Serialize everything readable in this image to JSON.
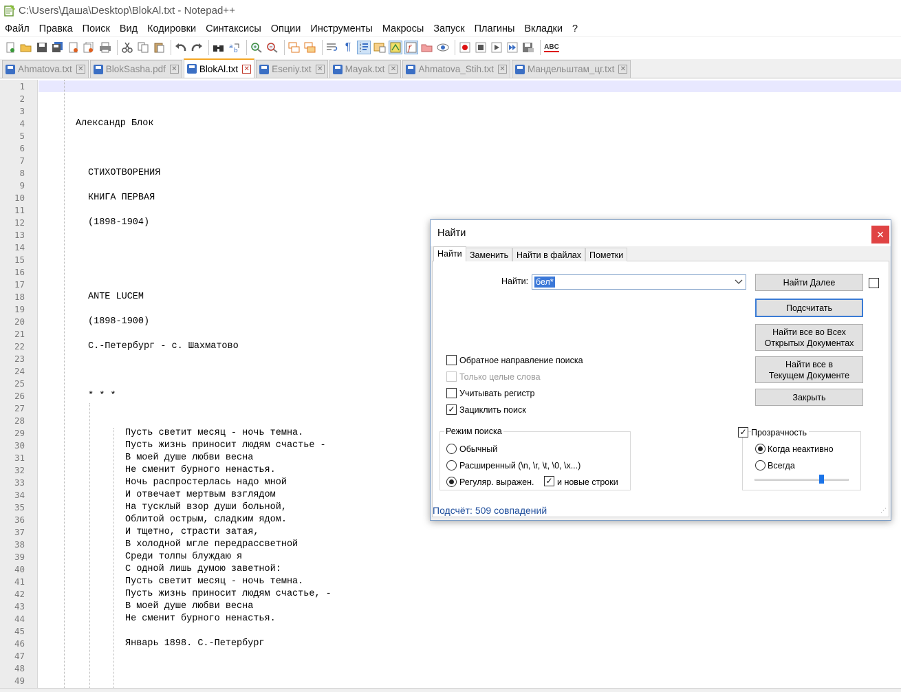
{
  "window": {
    "title": "C:\\Users\\Даша\\Desktop\\BlokAl.txt - Notepad++"
  },
  "menu": [
    "Файл",
    "Правка",
    "Поиск",
    "Вид",
    "Кодировки",
    "Синтаксисы",
    "Опции",
    "Инструменты",
    "Макросы",
    "Запуск",
    "Плагины",
    "Вкладки",
    "?"
  ],
  "toolbar": {
    "spell_label": "ABC"
  },
  "tabs": [
    {
      "label": "Ahmatova.txt",
      "active": false
    },
    {
      "label": "BlokSasha.pdf",
      "active": false
    },
    {
      "label": "BlokAl.txt",
      "active": true
    },
    {
      "label": "Eseniy.txt",
      "active": false
    },
    {
      "label": "Mayak.txt",
      "active": false
    },
    {
      "label": "Ahmatova_Stih.txt",
      "active": false
    },
    {
      "label": "Мандельштам_цг.txt",
      "active": false
    }
  ],
  "editor": {
    "line_numbers": [
      "1",
      "2",
      "3",
      "4",
      "5",
      "6",
      "7",
      "8",
      "9",
      "10",
      "11",
      "12",
      "13",
      "14",
      "15",
      "16",
      "17",
      "18",
      "19",
      "20",
      "21",
      "22",
      "23",
      "24",
      "25",
      "26",
      "27",
      "28",
      "29",
      "30",
      "31",
      "32",
      "33",
      "34",
      "35",
      "36",
      "37",
      "38",
      "39",
      "40",
      "41",
      "42",
      "43",
      "44",
      "45",
      "46",
      "47",
      "48",
      "49"
    ],
    "lines": [
      {
        "n": 4,
        "text": "Александр Блок"
      },
      {
        "n": 8,
        "text": "СТИХОТВОРЕНИЯ"
      },
      {
        "n": 10,
        "text": "КНИГА ПЕРВАЯ"
      },
      {
        "n": 12,
        "text": "(1898-1904)"
      },
      {
        "n": 18,
        "text": "ANTE LUCEM"
      },
      {
        "n": 20,
        "text": "(1898-1900)"
      },
      {
        "n": 22,
        "text": "С.-Петербург - с. Шахматово"
      },
      {
        "n": 26,
        "text": "* * *"
      },
      {
        "n": 29,
        "text": "Пусть светит месяц - ночь темна."
      },
      {
        "n": 30,
        "text": "Пусть жизнь приносит людям счастье -"
      },
      {
        "n": 31,
        "text": "В моей душе любви весна"
      },
      {
        "n": 32,
        "text": "Не сменит бурного ненастья."
      },
      {
        "n": 33,
        "text": "Ночь распростерлась надо мной"
      },
      {
        "n": 34,
        "text": "И отвечает мертвым взглядом"
      },
      {
        "n": 35,
        "text": "На тусклый взор души больной,"
      },
      {
        "n": 36,
        "text": "Облитой острым, сладким ядом."
      },
      {
        "n": 37,
        "text": "И тщетно, страсти затая,"
      },
      {
        "n": 38,
        "text": "В холодной мгле передрассветной"
      },
      {
        "n": 39,
        "text": "Среди толпы блуждаю я"
      },
      {
        "n": 40,
        "text": "С одной лишь думою заветной:"
      },
      {
        "n": 41,
        "text": "Пусть светит месяц - ночь темна."
      },
      {
        "n": 42,
        "text": "Пусть жизнь приносит людям счастье, -"
      },
      {
        "n": 43,
        "text": "В моей душе любви весна"
      },
      {
        "n": 44,
        "text": "Не сменит бурного ненастья."
      },
      {
        "n": 46,
        "text": "Январь 1898. С.-Петербург"
      }
    ]
  },
  "find_dialog": {
    "title": "Найти",
    "close": "✕",
    "tabs": [
      "Найти",
      "Заменить",
      "Найти в файлах",
      "Пометки"
    ],
    "find_label": "Найти:",
    "find_value": "бел*",
    "buttons": {
      "find_next": "Найти Далее",
      "count": "Подсчитать",
      "find_all_open_1": "Найти все во Всех",
      "find_all_open_2": "Открытых Документах",
      "find_all_current_1": "Найти все в",
      "find_all_current_2": "Текущем Документе",
      "close": "Закрыть"
    },
    "options": {
      "backward": {
        "label": "Обратное направление поиска",
        "checked": false
      },
      "whole_word": {
        "label": "Только целые слова",
        "checked": false,
        "disabled": true
      },
      "match_case": {
        "label": "Учитывать регистр",
        "checked": false
      },
      "wrap": {
        "label": "Зациклить поиск",
        "checked": true
      }
    },
    "search_mode": {
      "title": "Режим поиска",
      "normal": "Обычный",
      "extended": "Расширенный (\\n, \\r, \\t, \\0, \\x...)",
      "regex": "Регуляр. выражен.",
      "newline": "и новые строки",
      "selected": "regex",
      "newline_checked": true
    },
    "transparency": {
      "label": "Прозрачность",
      "checked": true,
      "on_lose_focus": "Когда неактивно",
      "always": "Всегда",
      "selected": "on_lose_focus",
      "level": 0.7
    },
    "status": "Подсчёт: 509 совпадений"
  }
}
